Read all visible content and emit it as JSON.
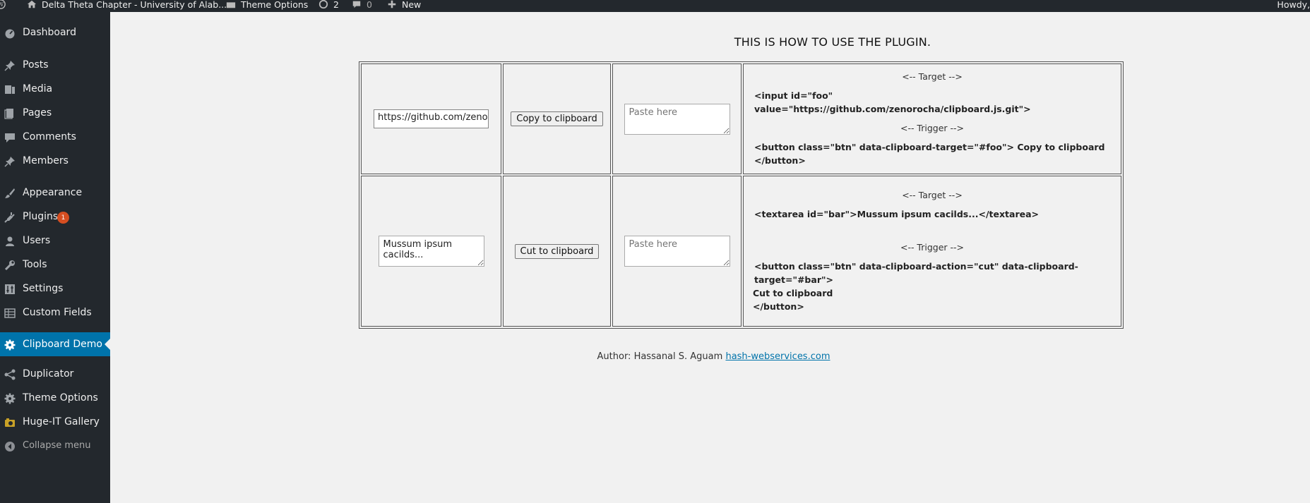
{
  "adminbar": {
    "site_name": "Delta Theta Chapter - University of Alab...",
    "theme_options": "Theme Options",
    "updates_count": "2",
    "comments_count": "0",
    "new_label": "New",
    "howdy": "Howdy, "
  },
  "sidebar": {
    "items": [
      {
        "label": "Dashboard",
        "icon": "dashboard-icon"
      },
      {
        "label": "Posts",
        "icon": "pin-icon"
      },
      {
        "label": "Media",
        "icon": "media-icon"
      },
      {
        "label": "Pages",
        "icon": "pages-icon"
      },
      {
        "label": "Comments",
        "icon": "comment-icon"
      },
      {
        "label": "Members",
        "icon": "pin-icon"
      },
      {
        "label": "Appearance",
        "icon": "brush-icon"
      },
      {
        "label": "Plugins",
        "icon": "plugin-icon",
        "badge": "1"
      },
      {
        "label": "Users",
        "icon": "user-icon"
      },
      {
        "label": "Tools",
        "icon": "wrench-icon"
      },
      {
        "label": "Settings",
        "icon": "settings-icon"
      },
      {
        "label": "Custom Fields",
        "icon": "table-icon"
      },
      {
        "label": "Clipboard Demo",
        "icon": "gear-icon",
        "current": true
      },
      {
        "label": "Duplicator",
        "icon": "share-icon"
      },
      {
        "label": "Theme Options",
        "icon": "gear-icon"
      },
      {
        "label": "Huge-IT Gallery",
        "icon": "camera-icon"
      },
      {
        "label": "Collapse menu",
        "icon": "collapse-icon"
      }
    ]
  },
  "main": {
    "title": "THIS IS HOW TO USE THE PLUGIN.",
    "row1": {
      "url_value": "https://github.com/zenorocha/clipboard.js.git",
      "button_label": "Copy to clipboard",
      "paste_placeholder": "Paste here",
      "target_comment": "<-- Target -->",
      "target_code": "<input id=\"foo\" value=\"https://github.com/zenorocha/clipboard.js.git\">",
      "trigger_comment": "<-- Trigger -->",
      "trigger_code": "<button class=\"btn\" data-clipboard-target=\"#foo\"> Copy to clipboard </button>"
    },
    "row2": {
      "textarea_value": "Mussum ipsum cacilds...",
      "button_label": "Cut to clipboard",
      "paste_placeholder": "Paste here",
      "target_comment": "<-- Target -->",
      "target_code": "<textarea id=\"bar\">Mussum ipsum cacilds...</textarea>",
      "trigger_comment": "<-- Trigger -->",
      "trigger_code_line1": "<button class=\"btn\" data-clipboard-action=\"cut\" data-clipboard-target=\"#bar\">",
      "trigger_code_line2": "Cut to clipboard",
      "trigger_code_line3": "</button>"
    },
    "author_label": "Author: Hassanal S. Aguam",
    "author_link": "hash-webservices.com"
  },
  "colors": {
    "admin_dark": "#23282d",
    "accent": "#0073aa",
    "badge": "#d54e21",
    "background": "#f1f1f1"
  }
}
